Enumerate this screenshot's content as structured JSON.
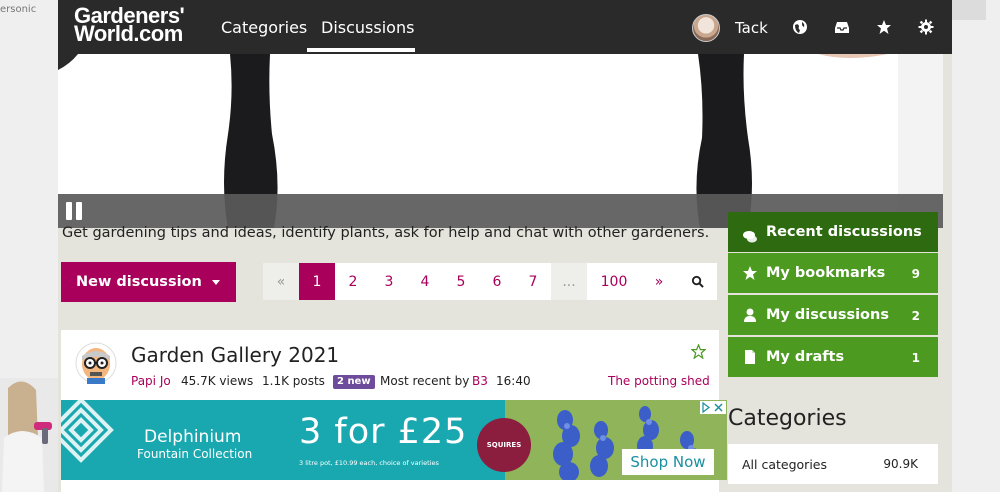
{
  "gutter": {
    "left_text": "ersonic"
  },
  "header": {
    "logo_line1": "Gardeners'",
    "logo_line2": "World.com",
    "nav": [
      {
        "label": "Categories"
      },
      {
        "label": "Discussions",
        "active": true
      }
    ],
    "username": "Tack",
    "icons": [
      "globe-icon",
      "inbox-icon",
      "star-icon",
      "gear-icon"
    ]
  },
  "video_ad": {
    "control_icon": "pause-icon"
  },
  "main": {
    "tagline": "Get gardening tips and ideas, identify plants, ask for help and chat with other gardeners.",
    "new_discussion_label": "New discussion",
    "pager": {
      "prev": "«",
      "pages": [
        "1",
        "2",
        "3",
        "4",
        "5",
        "6",
        "7"
      ],
      "current": "1",
      "ellipsis": "...",
      "last": "100",
      "next": "»"
    },
    "thread": {
      "title": "Garden Gallery 2021",
      "author": "Papi Jo",
      "views": "45.7K views",
      "posts": "1.1K posts",
      "new_badge": "2 new",
      "most_recent_label": "Most recent by",
      "most_recent_user": "B3",
      "time": "16:40",
      "category": "The potting shed"
    },
    "ad": {
      "plant": "Delphinium",
      "collection": "Fountain Collection",
      "offer": "3 for £25",
      "small_print": "3 litre pot, £10.99 each, choice of varieties",
      "brand": "SQUIRES",
      "since": "Since 1797",
      "cta": "Shop Now"
    }
  },
  "sidebar": {
    "items": [
      {
        "label": "Recent discussions",
        "count": "",
        "icon": "chat-icon"
      },
      {
        "label": "My bookmarks",
        "count": "9",
        "icon": "star-icon"
      },
      {
        "label": "My discussions",
        "count": "2",
        "icon": "user-icon"
      },
      {
        "label": "My drafts",
        "count": "1",
        "icon": "document-icon"
      }
    ],
    "categories_heading": "Categories",
    "categories": [
      {
        "label": "All categories",
        "count": "90.9K"
      }
    ]
  },
  "colors": {
    "brand_magenta": "#a8005b",
    "sidebar_green": "#4c9a1f",
    "header_dark": "#2a2a2a",
    "new_badge_purple": "#6f4b9b"
  }
}
